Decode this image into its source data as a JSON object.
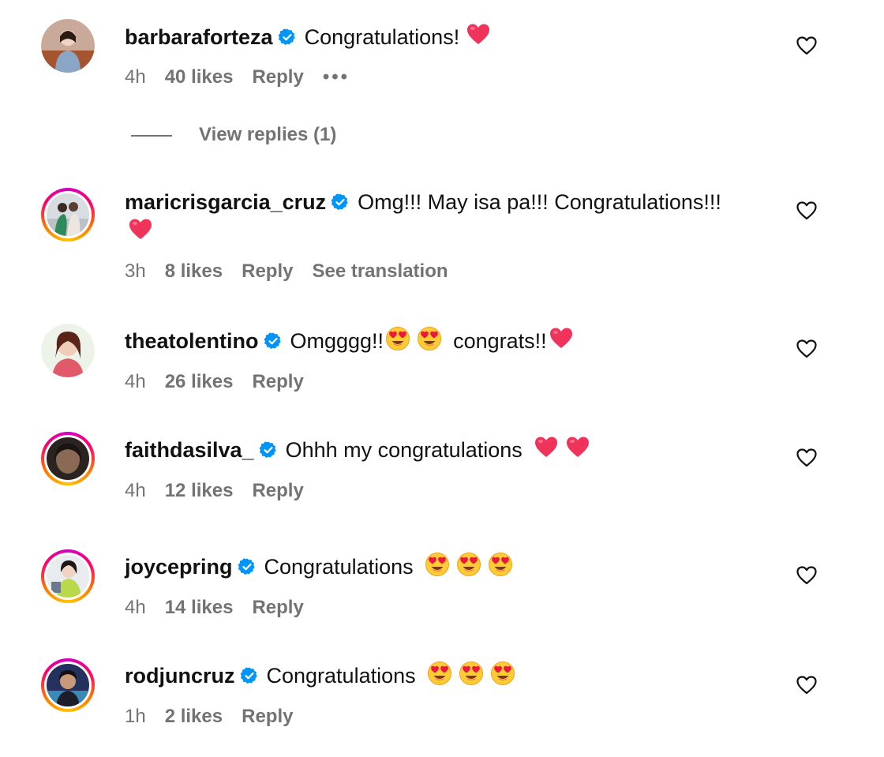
{
  "comments": [
    {
      "username": "barbaraforteza",
      "text": "Congratulations!",
      "emojis": [
        "heart"
      ],
      "time": "4h",
      "likes": "40 likes",
      "reply": "Reply",
      "extra": "•••",
      "view_replies": "View replies (1)"
    },
    {
      "username": "maricrisgarcia_cruz",
      "text": "Omg!!! May isa pa!!! Congratulations!!!",
      "emojis": [
        "heart"
      ],
      "time": "3h",
      "likes": "8 likes",
      "reply": "Reply",
      "extra": "See translation"
    },
    {
      "username": "theatolentino",
      "text_before": "Omgggg!!",
      "text_after": "congrats!!",
      "emojis": [
        "heart-eyes",
        "heart-eyes",
        "heart"
      ],
      "time": "4h",
      "likes": "26 likes",
      "reply": "Reply"
    },
    {
      "username": "faithdasilva_",
      "text": "Ohhh my congratulations",
      "emojis": [
        "heart",
        "heart"
      ],
      "time": "4h",
      "likes": "12 likes",
      "reply": "Reply"
    },
    {
      "username": "joycepring",
      "text": "Congratulations",
      "emojis": [
        "heart-eyes",
        "heart-eyes",
        "heart-eyes"
      ],
      "time": "4h",
      "likes": "14 likes",
      "reply": "Reply"
    },
    {
      "username": "rodjuncruz",
      "text": "Congratulations",
      "emojis": [
        "heart-eyes",
        "heart-eyes",
        "heart-eyes"
      ],
      "time": "1h",
      "likes": "2 likes",
      "reply": "Reply"
    }
  ],
  "colors": {
    "verified": "#0095f6",
    "meta_text": "#737373",
    "heart_emoji": "#f0335a",
    "story_ring": [
      "#d300c5",
      "#ff0069",
      "#ff7a00",
      "#ffc400"
    ]
  }
}
